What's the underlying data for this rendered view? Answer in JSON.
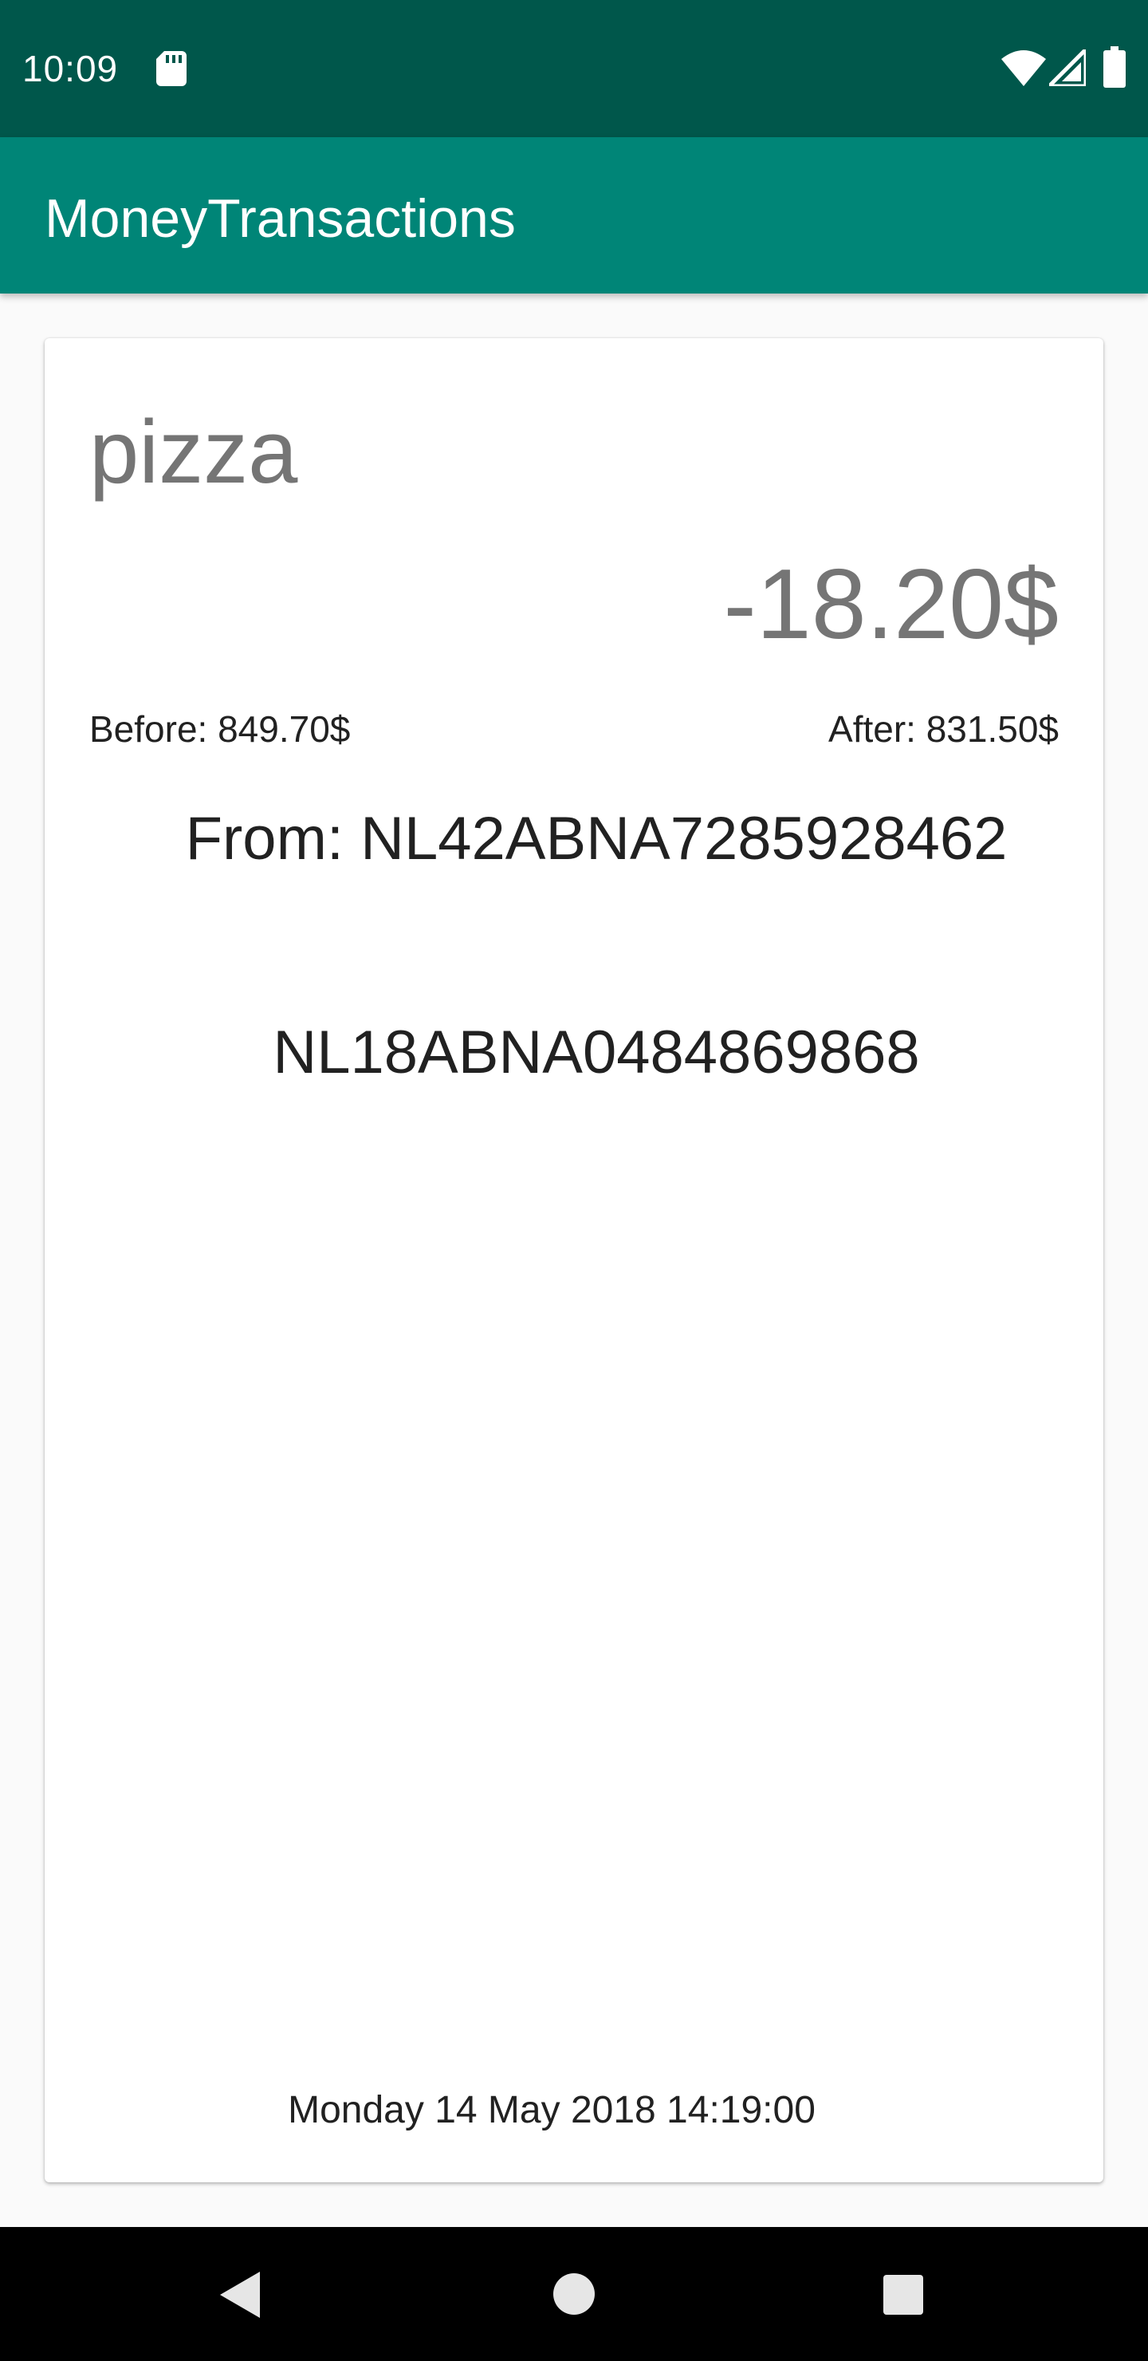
{
  "status_bar": {
    "time": "10:09",
    "icons": [
      "sd-card-icon",
      "wifi-icon",
      "cell-signal-icon",
      "battery-icon"
    ]
  },
  "app_bar": {
    "title": "MoneyTransactions"
  },
  "transaction": {
    "description": "pizza",
    "amount": "-18.20$",
    "balance_before": "Before: 849.70$",
    "balance_after": "After: 831.50$",
    "from": "From: NL42ABNA7285928462",
    "to_account": "NL18ABNA0484869868",
    "date": "Monday 14 May 2018 14:19:00"
  },
  "nav_bar": {
    "icons": [
      "back-icon",
      "home-icon",
      "recents-icon"
    ]
  },
  "colors": {
    "status_bar": "#00574b",
    "app_bar": "#008577",
    "background": "#fafafa",
    "card": "#ffffff",
    "muted_text": "#757575",
    "primary_text": "#212121"
  }
}
